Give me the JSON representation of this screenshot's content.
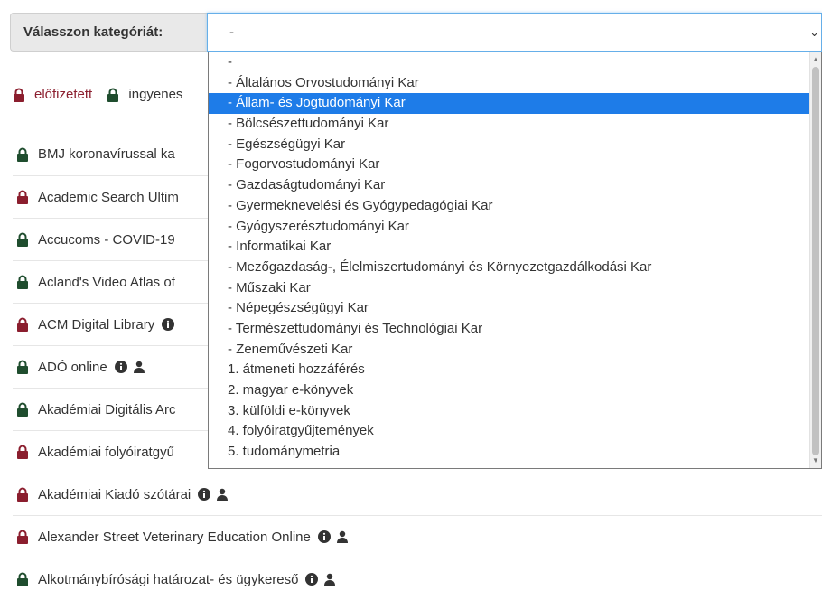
{
  "category": {
    "label": "Válasszon kategóriát:",
    "selected_value": "-"
  },
  "legend": {
    "paid": "előfizetett",
    "free": "ingyenes"
  },
  "colors": {
    "paid_lock": "#8b1e2e",
    "free_lock": "#1f4d2e",
    "selected_option_bg": "#1e7ce8"
  },
  "resources": [
    {
      "name": "BMJ koronavírussal ka",
      "access": "free",
      "info": false,
      "user": false
    },
    {
      "name": "Academic Search Ultim",
      "access": "paid",
      "info": false,
      "user": false
    },
    {
      "name": "Accucoms - COVID-19",
      "access": "free",
      "info": false,
      "user": false
    },
    {
      "name": "Acland's Video Atlas of",
      "access": "free",
      "info": false,
      "user": false
    },
    {
      "name": "ACM Digital Library",
      "access": "paid",
      "info": true,
      "user": false
    },
    {
      "name": "ADÓ online",
      "access": "free",
      "info": true,
      "user": true
    },
    {
      "name": "Akadémiai Digitális Arc",
      "access": "free",
      "info": false,
      "user": false
    },
    {
      "name": "Akadémiai folyóiratgyű",
      "access": "paid",
      "info": false,
      "user": false
    },
    {
      "name": "Akadémiai Kiadó szótárai",
      "access": "paid",
      "info": true,
      "user": true
    },
    {
      "name": "Alexander Street Veterinary Education Online",
      "access": "paid",
      "info": true,
      "user": true
    },
    {
      "name": "Alkotmánybírósági határozat- és ügykereső",
      "access": "free",
      "info": true,
      "user": true
    }
  ],
  "dropdown": {
    "selected_index": 2,
    "options": [
      "-",
      "- Általános Orvostudományi Kar",
      "- Állam- és Jogtudományi Kar",
      "- Bölcsészettudományi Kar",
      "- Egészségügyi Kar",
      "- Fogorvostudományi Kar",
      "- Gazdaságtudományi Kar",
      "- Gyermeknevelési és Gyógypedagógiai Kar",
      "- Gyógyszerésztudományi Kar",
      "- Informatikai Kar",
      "- Mezőgazdaság-, Élelmiszertudományi és Környezetgazdálkodási Kar",
      "- Műszaki Kar",
      "- Népegészségügyi Kar",
      "- Természettudományi és Technológiai Kar",
      "- Zeneművészeti Kar",
      "1. átmeneti hozzáférés",
      "2. magyar e-könyvek",
      "3. külföldi e-könyvek",
      "4. folyóiratgyűjtemények",
      "5. tudománymetria"
    ]
  }
}
